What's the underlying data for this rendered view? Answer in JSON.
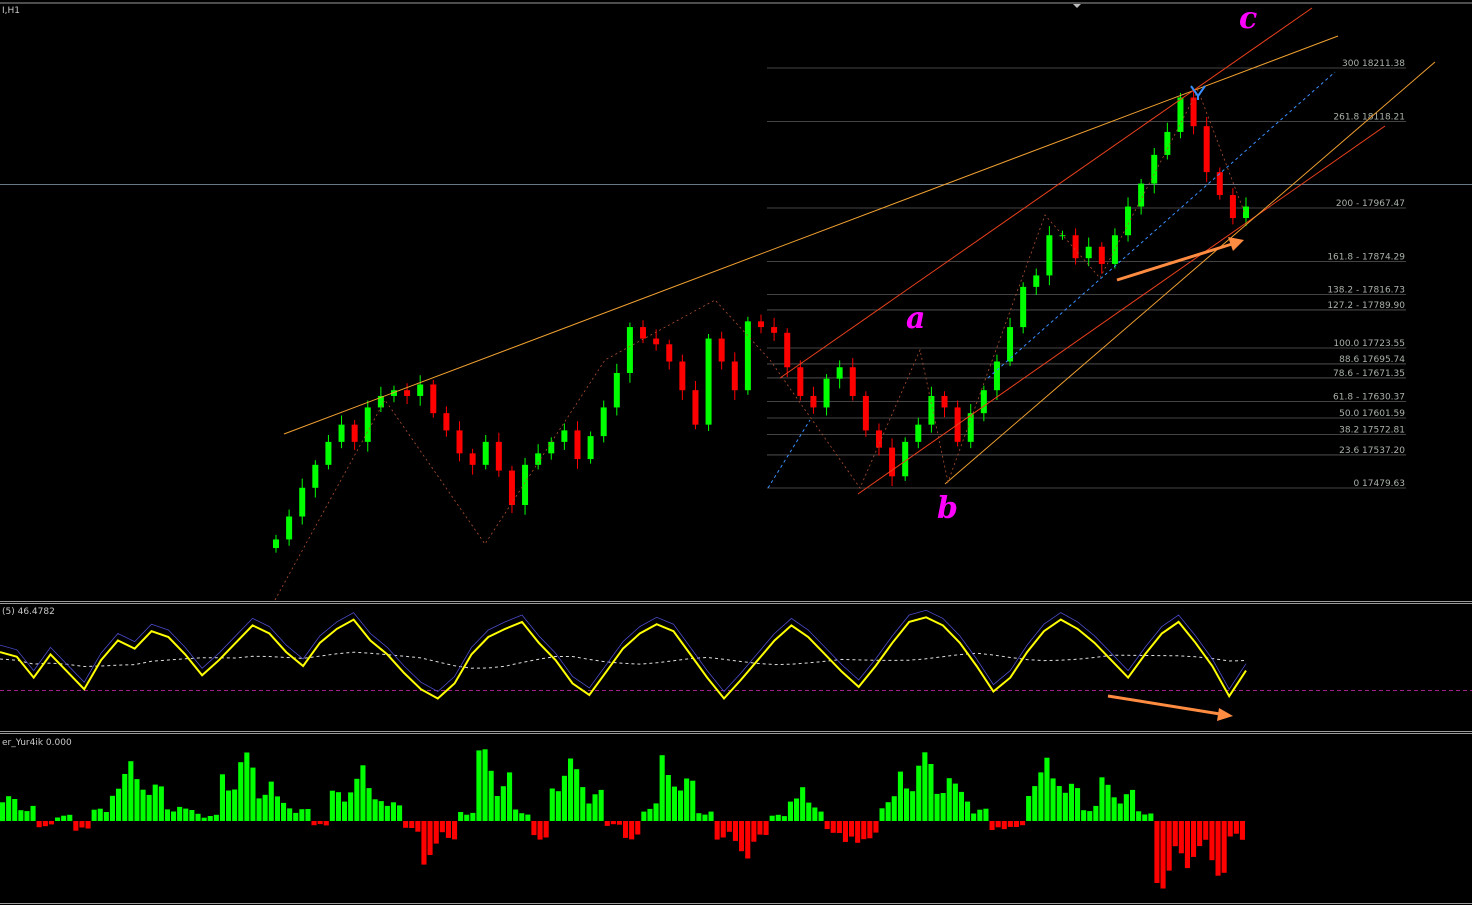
{
  "header": {
    "timeframe_label": "I,H1"
  },
  "waves": {
    "a": "a",
    "b": "b",
    "c": "c"
  },
  "fibonacci": {
    "levels": [
      {
        "ratio": "300",
        "price": 18211.38,
        "text": "300 18211.38"
      },
      {
        "ratio": "261.8",
        "price": 18118.21,
        "text": "261.8 18118.21"
      },
      {
        "ratio": "200",
        "price": 17967.47,
        "text": "200 - 17967.47"
      },
      {
        "ratio": "161.8",
        "price": 17874.29,
        "text": "161.8 - 17874.29"
      },
      {
        "ratio": "138.2",
        "price": 17816.73,
        "text": "138.2 - 17816.73"
      },
      {
        "ratio": "127.2",
        "price": 17789.9,
        "text": "127.2 - 17789.90"
      },
      {
        "ratio": "100.0",
        "price": 17723.55,
        "text": "100.0 17723.55"
      },
      {
        "ratio": "88.6",
        "price": 17695.74,
        "text": "88.6 17695.74"
      },
      {
        "ratio": "78.6",
        "price": 17671.35,
        "text": "78.6 - 17671.35"
      },
      {
        "ratio": "61.8",
        "price": 17630.37,
        "text": "61.8 - 17630.37"
      },
      {
        "ratio": "50.0",
        "price": 17601.59,
        "text": "50.0 17601.59"
      },
      {
        "ratio": "38.2",
        "price": 17572.81,
        "text": "38.2 17572.81"
      },
      {
        "ratio": "23.6",
        "price": 17537.2,
        "text": "23.6 17537.20"
      },
      {
        "ratio": "0",
        "price": 17479.63,
        "text": "0 17479.63"
      }
    ]
  },
  "oscillator": {
    "label": "(5) 46.4782"
  },
  "histogram": {
    "label": "er_Yur4ik 0.000"
  },
  "colors": {
    "bull": "#00ff00",
    "bear": "#ff0000",
    "fib_line": "#5a5a5a",
    "trend_orange": "#f0a030",
    "channel_red": "#e8401c",
    "arrow": "#ff8c40",
    "oscillator_main": "#ffff00",
    "wave_label": "#ff00ff",
    "marker_blue": "#3a8fff"
  },
  "chart_data": [
    {
      "type": "candlestick",
      "panel": "price",
      "values": [
        17390,
        17430,
        17480,
        17520,
        17560,
        17590,
        17560,
        17620,
        17640,
        17650,
        17640,
        17660,
        17610,
        17580,
        17540,
        17520,
        17560,
        17510,
        17450,
        17520,
        17540,
        17560,
        17580,
        17530,
        17570,
        17620,
        17680,
        17760,
        17740,
        17730,
        17700,
        17650,
        17590,
        17740,
        17700,
        17650,
        17770,
        17760,
        17750,
        17690,
        17640,
        17620,
        17670,
        17690,
        17640,
        17580,
        17550,
        17500,
        17560,
        17590,
        17640,
        17620,
        17560,
        17610,
        17650,
        17700,
        17760,
        17830,
        17850,
        17920,
        17920,
        17880,
        17900,
        17870,
        17920,
        17970,
        18010,
        18060,
        18100,
        18160,
        18110,
        18030,
        17990,
        17950,
        17970
      ],
      "price_range": [
        17300,
        18300
      ]
    },
    {
      "type": "line",
      "panel": "oscillator",
      "name": "(5) 46.4782",
      "values": [
        62,
        58,
        40,
        60,
        45,
        30,
        55,
        72,
        65,
        80,
        75,
        60,
        42,
        55,
        70,
        85,
        78,
        62,
        50,
        70,
        82,
        90,
        72,
        60,
        44,
        30,
        22,
        35,
        60,
        75,
        82,
        88,
        70,
        55,
        35,
        25,
        45,
        65,
        78,
        86,
        80,
        60,
        40,
        22,
        38,
        55,
        72,
        85,
        75,
        60,
        45,
        32,
        50,
        70,
        88,
        92,
        85,
        70,
        50,
        28,
        40,
        62,
        80,
        90,
        82,
        70,
        55,
        40,
        60,
        78,
        88,
        70,
        50,
        24,
        46
      ],
      "range": [
        0,
        100
      ]
    },
    {
      "type": "bar",
      "panel": "histogram",
      "name": "er_Yur4ik 0.000",
      "values": [
        0.4,
        0.3,
        -0.1,
        0.1,
        -0.2,
        0.2,
        0.8,
        1.0,
        0.6,
        0.3,
        0.2,
        0.1,
        0.9,
        1.1,
        0.7,
        0.4,
        0.2,
        -0.1,
        0.5,
        0.9,
        0.6,
        0.3,
        -0.2,
        -0.7,
        -0.3,
        0.2,
        1.2,
        0.8,
        0.2,
        -0.3,
        0.9,
        1.0,
        0.5,
        -0.1,
        -0.3,
        0.3,
        1.1,
        0.7,
        0.2,
        -0.3,
        -0.6,
        -0.4,
        0.1,
        0.6,
        0.3,
        -0.2,
        -0.5,
        -0.3,
        0.4,
        0.9,
        1.1,
        0.8,
        0.6,
        0.2,
        -0.2,
        -0.1,
        0.8,
        1.1,
        0.6,
        0.3,
        0.7,
        0.5,
        0.2,
        -1.1,
        -0.8,
        -0.6,
        -0.9,
        -0.4
      ],
      "range": [
        -1.2,
        1.2
      ]
    }
  ]
}
